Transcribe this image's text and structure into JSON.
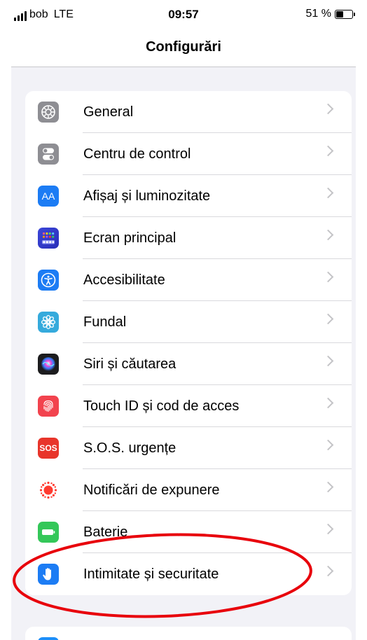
{
  "status_bar": {
    "carrier": "bob",
    "network": "LTE",
    "time": "09:57",
    "battery_text": "51 %",
    "battery_level": 0.51
  },
  "nav": {
    "title": "Configurări"
  },
  "settings": {
    "items": [
      {
        "label": "General",
        "icon": "gear-icon",
        "color": "#8e8e93"
      },
      {
        "label": "Centru de control",
        "icon": "toggles-icon",
        "color": "#8e8e93"
      },
      {
        "label": "Afișaj și luminozitate",
        "icon": "text-size-icon",
        "icon_text": "AA",
        "color": "#1c7cf4"
      },
      {
        "label": "Ecran principal",
        "icon": "home-grid-icon",
        "color": "#3a3ad4"
      },
      {
        "label": "Accesibilitate",
        "icon": "accessibility-icon",
        "color": "#1c7cf4"
      },
      {
        "label": "Fundal",
        "icon": "flower-icon",
        "color": "#35aadc"
      },
      {
        "label": "Siri și căutarea",
        "icon": "siri-icon",
        "color": "#1c1c1e"
      },
      {
        "label": "Touch ID și cod de acces",
        "icon": "fingerprint-icon",
        "color": "#f2434e"
      },
      {
        "label": "S.O.S. urgențe",
        "icon": "sos-icon",
        "icon_text": "SOS",
        "color": "#e8352b"
      },
      {
        "label": "Notificări de expunere",
        "icon": "exposure-icon",
        "color": "#ff3b30"
      },
      {
        "label": "Baterie",
        "icon": "battery-icon",
        "color": "#34c759"
      },
      {
        "label": "Intimitate și securitate",
        "icon": "hand-icon",
        "color": "#1c7cf4"
      }
    ]
  },
  "annotation": {
    "color": "#e8000b"
  }
}
